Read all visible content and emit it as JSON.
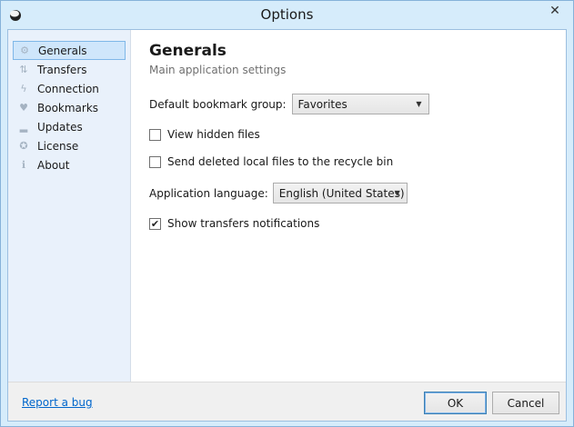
{
  "window": {
    "title": "Options",
    "close_glyph": "✕"
  },
  "sidebar": {
    "items": [
      {
        "label": "Generals",
        "icon": "gear-icon",
        "glyph": "⚙"
      },
      {
        "label": "Transfers",
        "icon": "transfers-icon",
        "glyph": "⇅"
      },
      {
        "label": "Connection",
        "icon": "lightning-icon",
        "glyph": "ϟ"
      },
      {
        "label": "Bookmarks",
        "icon": "heart-icon",
        "glyph": "♥"
      },
      {
        "label": "Updates",
        "icon": "updates-icon",
        "glyph": "▂"
      },
      {
        "label": "License",
        "icon": "license-icon",
        "glyph": "✪"
      },
      {
        "label": "About",
        "icon": "info-icon",
        "glyph": "ℹ"
      }
    ]
  },
  "main": {
    "title": "Generals",
    "subtitle": "Main application settings",
    "bookmark_group": {
      "label": "Default bookmark group:",
      "value": "Favorites"
    },
    "view_hidden": {
      "label": "View hidden files",
      "checked": false
    },
    "send_deleted": {
      "label": "Send deleted local files to the recycle bin",
      "checked": false
    },
    "language": {
      "label": "Application language:",
      "value": "English (United States)"
    },
    "show_notifications": {
      "label": "Show transfers notifications",
      "checked": true,
      "check_glyph": "✔"
    }
  },
  "footer": {
    "report_link": "Report a bug",
    "ok_label": "OK",
    "cancel_label": "Cancel"
  },
  "colors": {
    "accent": "#7fb7e8",
    "sidebar_bg": "#e9f1fb",
    "link": "#0066cc"
  }
}
